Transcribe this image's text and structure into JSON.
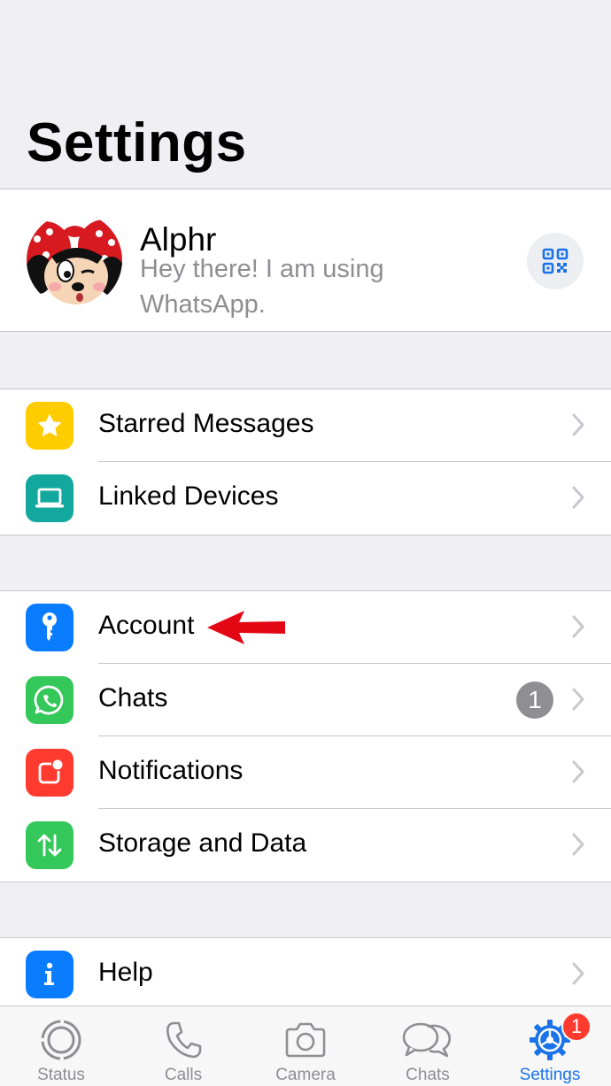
{
  "header": {
    "title": "Settings"
  },
  "profile": {
    "name": "Alphr",
    "status": "Hey there! I am using WhatsApp."
  },
  "groups": [
    {
      "items": [
        {
          "label": "Starred Messages",
          "icon": "star-icon",
          "color": "#ffcc00"
        },
        {
          "label": "Linked Devices",
          "icon": "laptop-icon",
          "color": "#13a89e"
        }
      ]
    },
    {
      "items": [
        {
          "label": "Account",
          "icon": "key-icon",
          "color": "#0a7cff"
        },
        {
          "label": "Chats",
          "icon": "whatsapp-icon",
          "color": "#34c759",
          "badge": "1"
        },
        {
          "label": "Notifications",
          "icon": "notification-icon",
          "color": "#ff3b30"
        },
        {
          "label": "Storage and Data",
          "icon": "arrows-updown-icon",
          "color": "#34c759"
        }
      ]
    },
    {
      "items": [
        {
          "label": "Help",
          "icon": "info-icon",
          "color": "#0a7cff"
        }
      ]
    }
  ],
  "tabbar": {
    "tabs": [
      {
        "label": "Status",
        "icon": "status-icon"
      },
      {
        "label": "Calls",
        "icon": "phone-icon"
      },
      {
        "label": "Camera",
        "icon": "camera-icon"
      },
      {
        "label": "Chats",
        "icon": "chat-bubbles-icon"
      },
      {
        "label": "Settings",
        "icon": "gear-icon",
        "active": true,
        "badge": "1"
      }
    ]
  },
  "colors": {
    "accent": "#1a73e8",
    "annotation": "#e30613"
  }
}
